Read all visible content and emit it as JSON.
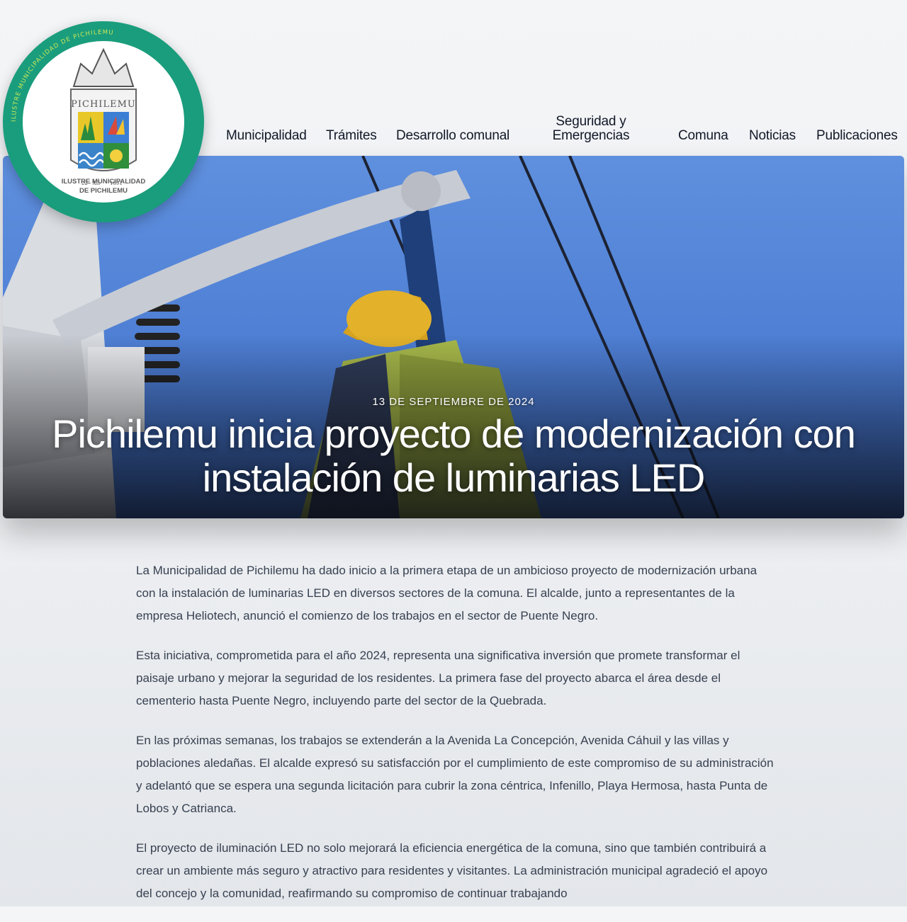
{
  "header": {
    "logo": {
      "ring_text": "ILUSTRE MUNICIPALIDAD DE PICHILEMU",
      "shield_title": "PICHILEMU",
      "shield_date_left": "22 - XII",
      "shield_date_right": "1891",
      "caption_line1": "ILUSTRE MUNICIPALIDAD",
      "caption_line2": "DE PICHILEMU",
      "ring_color": "#1a9d7c"
    },
    "nav": [
      {
        "label": "Municipalidad"
      },
      {
        "label": "Trámites"
      },
      {
        "label": "Desarrollo comunal"
      },
      {
        "label": "Seguridad y Emergencias"
      },
      {
        "label": "Comuna"
      },
      {
        "label": "Noticias"
      },
      {
        "label": "Publicaciones"
      }
    ]
  },
  "hero": {
    "date": "13 DE SEPTIEMBRE DE 2024",
    "title": "Pichilemu inicia proyecto de modernización con instalación de luminarias LED",
    "image_description_icon": "worker-on-power-pole-photo"
  },
  "article": {
    "paragraphs": [
      "La Municipalidad de Pichilemu ha dado inicio a la primera etapa de un ambicioso proyecto de modernización urbana con la instalación de luminarias LED en diversos sectores de la comuna. El alcalde, junto a representantes de la empresa Heliotech, anunció el comienzo de los trabajos en el sector de Puente Negro.",
      "Esta iniciativa, comprometida para el año 2024, representa una significativa inversión que promete transformar el paisaje urbano y mejorar la seguridad de los residentes. La primera fase del proyecto abarca el área desde el cementerio hasta Puente Negro, incluyendo parte del sector de la Quebrada.",
      "En las próximas semanas, los trabajos se extenderán a la Avenida La Concepción, Avenida Cáhuil y las villas y poblaciones aledañas. El alcalde expresó su satisfacción por el cumplimiento de este compromiso de su administración y adelantó que se espera una segunda licitación para cubrir la zona céntrica, Infenillo, Playa Hermosa, hasta Punta de Lobos y Catrianca.",
      "El proyecto de iluminación LED no solo mejorará la eficiencia energética de la comuna, sino que también contribuirá a crear un ambiente más seguro y atractivo para residentes y visitantes. La administración municipal agradeció el apoyo del concejo y la comunidad, reafirmando su compromiso de continuar trabajando"
    ]
  }
}
